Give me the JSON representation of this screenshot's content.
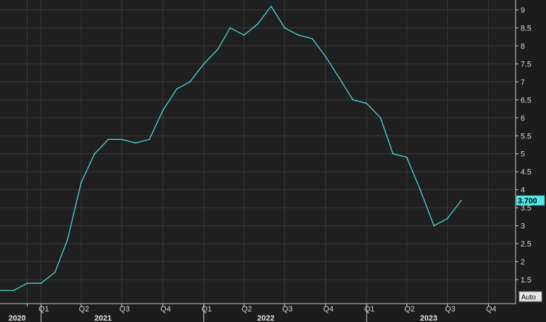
{
  "chart_data": {
    "type": "line",
    "ylim": [
      1.0,
      9.2
    ],
    "y_ticks": [
      1.5,
      2,
      2.5,
      3,
      3.5,
      4,
      4.5,
      5,
      5.5,
      6,
      6.5,
      7,
      7.5,
      8,
      8.5,
      9
    ],
    "x_ticks": [
      {
        "date": "2020-12-01",
        "label": ""
      },
      {
        "date": "2021-01-01",
        "label": "Q1"
      },
      {
        "date": "2021-04-01",
        "label": "Q2"
      },
      {
        "date": "2021-07-01",
        "label": "Q3"
      },
      {
        "date": "2021-10-01",
        "label": "Q4"
      },
      {
        "date": "2022-01-01",
        "label": "Q1"
      },
      {
        "date": "2022-04-01",
        "label": "Q2"
      },
      {
        "date": "2022-07-01",
        "label": "Q3"
      },
      {
        "date": "2022-10-01",
        "label": "Q4"
      },
      {
        "date": "2023-01-01",
        "label": "Q1"
      },
      {
        "date": "2023-04-01",
        "label": "Q2"
      },
      {
        "date": "2023-07-01",
        "label": "Q3"
      },
      {
        "date": "2023-10-01",
        "label": "Q4"
      }
    ],
    "x_range": [
      "2020-10-01",
      "2023-12-01"
    ],
    "year_labels": [
      {
        "label": "2020",
        "date": "2020-10-20"
      },
      {
        "label": "2021",
        "date": "2021-05-20"
      },
      {
        "label": "2022",
        "date": "2022-05-20"
      },
      {
        "label": "2023",
        "date": "2023-05-20"
      }
    ],
    "year_dividers": [
      "2021-01-01",
      "2022-01-01",
      "2023-01-01"
    ],
    "series": [
      {
        "color": "#4fe8e8",
        "x": [
          "2020-10-01",
          "2020-11-01",
          "2020-12-01",
          "2021-01-01",
          "2021-02-01",
          "2021-03-01",
          "2021-04-01",
          "2021-05-01",
          "2021-06-01",
          "2021-07-01",
          "2021-08-01",
          "2021-09-01",
          "2021-10-01",
          "2021-11-01",
          "2021-12-01",
          "2022-01-01",
          "2022-02-01",
          "2022-03-01",
          "2022-04-01",
          "2022-05-01",
          "2022-06-01",
          "2022-07-01",
          "2022-08-01",
          "2022-09-01",
          "2022-10-01",
          "2022-11-01",
          "2022-12-01",
          "2023-01-01",
          "2023-02-01",
          "2023-03-01",
          "2023-04-01",
          "2023-05-01",
          "2023-06-01",
          "2023-07-01",
          "2023-08-01"
        ],
        "values": [
          1.2,
          1.2,
          1.4,
          1.4,
          1.7,
          2.6,
          4.2,
          5.0,
          5.4,
          5.4,
          5.3,
          5.4,
          6.2,
          6.8,
          7.0,
          7.5,
          7.9,
          8.5,
          8.3,
          8.6,
          9.1,
          8.5,
          8.3,
          8.2,
          7.7,
          7.1,
          6.5,
          6.4,
          6.0,
          5.0,
          4.9,
          4.0,
          3.0,
          3.2,
          3.7
        ]
      }
    ],
    "last_value_label": "3.700",
    "grid": true,
    "scale_mode": "Auto",
    "colors": {
      "background": "#1c1c1c",
      "plot": "#1f1f1f",
      "grid": "#3a3a3a",
      "line": "#4fe8e8"
    }
  }
}
